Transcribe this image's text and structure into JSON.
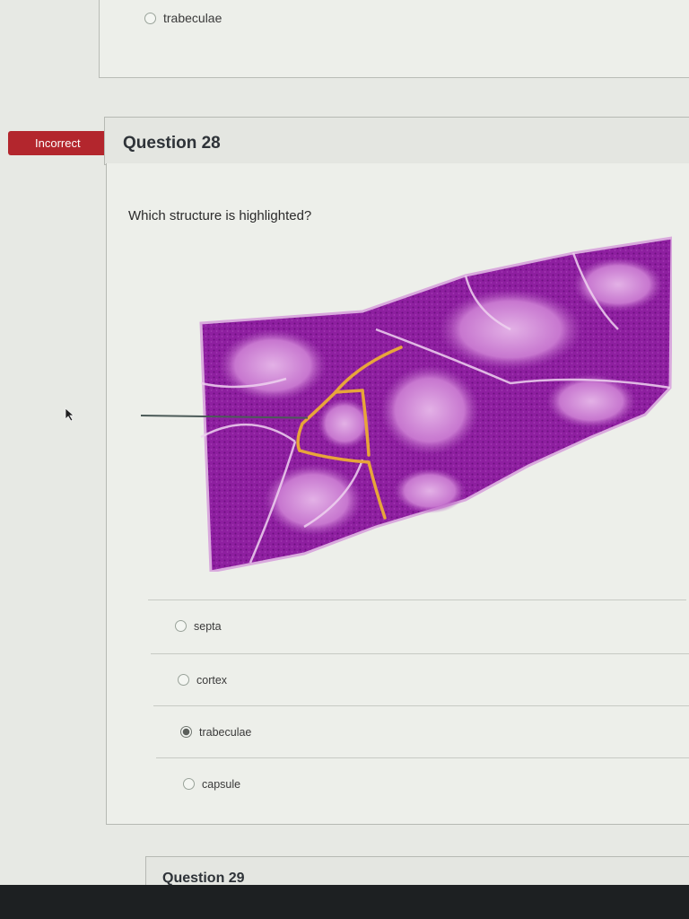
{
  "previous_question": {
    "last_option_label": "trabeculae"
  },
  "question28": {
    "status": "Incorrect",
    "title": "Question 28",
    "prompt": "Which structure is highlighted?",
    "answers": [
      {
        "label": "septa",
        "selected": false
      },
      {
        "label": "cortex",
        "selected": false
      },
      {
        "label": "trabeculae",
        "selected": true
      },
      {
        "label": "capsule",
        "selected": false
      }
    ]
  },
  "question29": {
    "title": "Question 29"
  },
  "colors": {
    "incorrect_badge": "#b3262d",
    "tissue_purple": "#8a1f9a",
    "highlight": "#e8a53a"
  }
}
